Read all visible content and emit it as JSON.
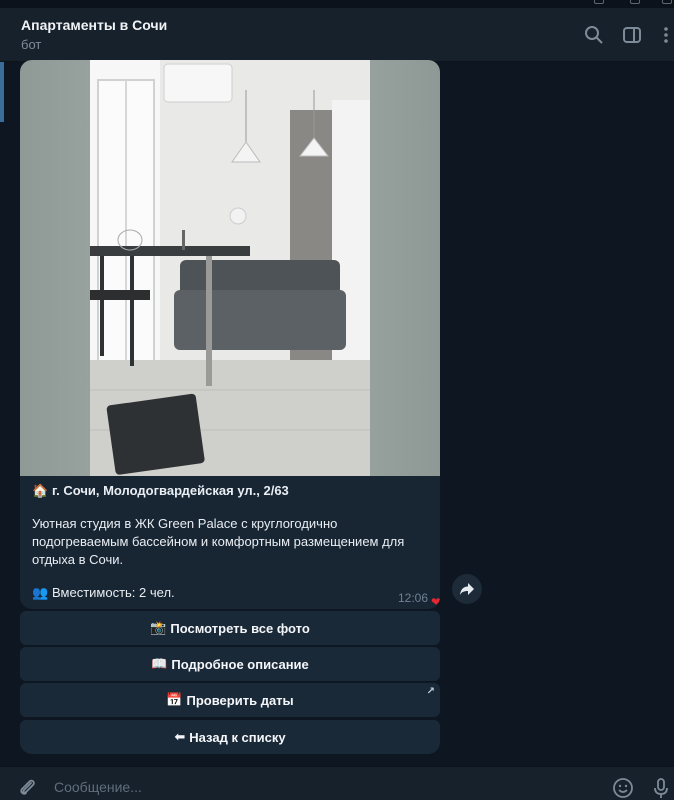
{
  "chat": {
    "title": "Апартаменты в Сочи",
    "subtitle": "бот"
  },
  "message": {
    "address_emoji": "🏠",
    "address": "г. Сочи, Молодогвардейская ул., 2/63",
    "description": "Уютная студия в ЖК Green Palace с круглогодично подогреваемым бассейном и комфортным размещением для отдыха в Сочи.",
    "capacity_emoji": "👥",
    "capacity": "Вместимость: 2 чел.",
    "time": "12:06",
    "reaction": "❤"
  },
  "keyboard": [
    {
      "icon": "📸",
      "label": "Посмотреть все фото"
    },
    {
      "icon": "📖",
      "label": "Подробное описание"
    },
    {
      "icon": "📅",
      "label": "Проверить даты",
      "arrow": "↗"
    },
    {
      "icon": "⬅",
      "label": "Назад к списку"
    }
  ],
  "composer": {
    "placeholder": "Сообщение..."
  },
  "icons": {
    "search": "search-icon",
    "sidebar": "sidebar-toggle-icon",
    "menu": "more-vertical-icon",
    "attach": "paperclip-icon",
    "emoji": "smile-icon",
    "mic": "microphone-icon",
    "share": "share-arrow-icon"
  },
  "colors": {
    "background": "#0e1621",
    "header": "#17212b",
    "bubble": "#182533",
    "button": "#1a2938",
    "muted": "#7d8b99",
    "heart": "#e4282f"
  }
}
